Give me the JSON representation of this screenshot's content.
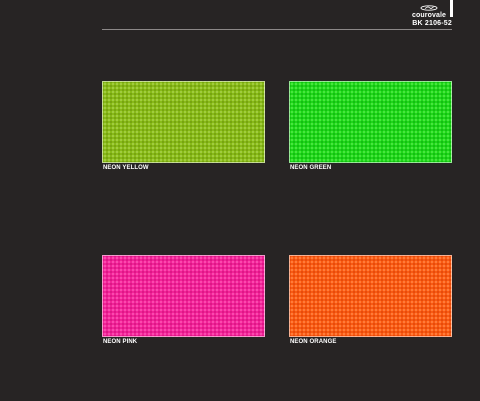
{
  "header": {
    "brand_name": "courovale",
    "brand_logo_icon": "brand-logo-icon",
    "product_code": "BK 2106-52"
  },
  "swatches": [
    {
      "label": "NEON YELLOW",
      "color": "#8fc21a",
      "texture_color": "#77a410"
    },
    {
      "label": "NEON GREEN",
      "color": "#24e01b",
      "texture_color": "#12bf12"
    },
    {
      "label": "NEON PINK",
      "color": "#f9279e",
      "texture_color": "#de1786"
    },
    {
      "label": "NEON ORANGE",
      "color": "#ff6115",
      "texture_color": "#e74a0b"
    }
  ],
  "colors": {
    "background": "#272424",
    "text": "#ffffff"
  }
}
